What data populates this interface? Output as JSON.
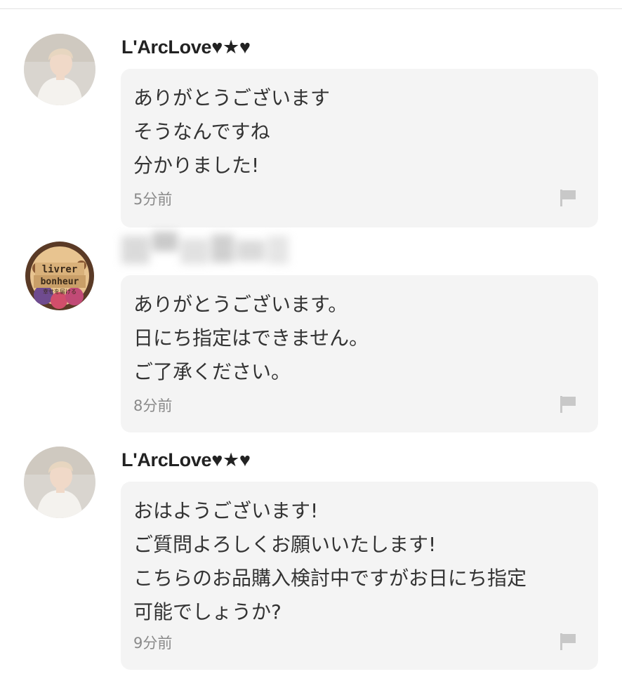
{
  "comments": [
    {
      "username": "L'ArcLove♥★♥",
      "username_hidden": false,
      "avatar": "user-photo-avatar",
      "lines": [
        "ありがとうございます",
        "そうなんですね",
        "分かりました!"
      ],
      "time": "5分前",
      "flag_icon": "flag-icon"
    },
    {
      "username": "",
      "username_hidden": true,
      "avatar": "shop-logo-avatar",
      "lines": [
        "ありがとうございます。",
        "日にち指定はできません。",
        "ご了承ください。"
      ],
      "time": "8分前",
      "flag_icon": "flag-icon"
    },
    {
      "username": "L'ArcLove♥★♥",
      "username_hidden": false,
      "avatar": "user-photo-avatar",
      "lines": [
        "おはようございます!",
        "ご質問よろしくお願いいたします!",
        "こちらのお品購入検討中ですがお日にち指定",
        "可能でしょうか?"
      ],
      "time": "9分前",
      "flag_icon": "flag-icon"
    }
  ],
  "shop_logo_text": {
    "line1": "livrer",
    "line2": "bonheur",
    "line3": "幸せを届ける"
  },
  "colors": {
    "bubble_bg": "#f4f4f4",
    "text": "#333333",
    "timestamp": "#8a8a8a",
    "flag": "#c8c8c8"
  }
}
